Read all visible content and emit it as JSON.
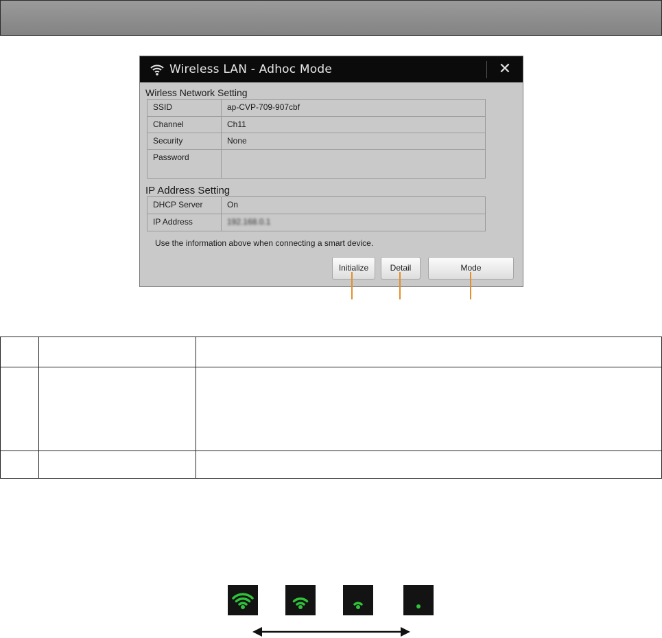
{
  "dialog": {
    "title": "Wireless LAN - Adhoc Mode",
    "title_icon": "wifi-icon",
    "close_icon": "close-icon",
    "close_glyph": "✕",
    "wireless_section": {
      "title": "Wirless Network Setting",
      "rows": [
        {
          "label": "SSID",
          "value": "ap-CVP-709-907cbf"
        },
        {
          "label": "Channel",
          "value": "Ch11"
        },
        {
          "label": "Security",
          "value": "None"
        },
        {
          "label": "Password",
          "value": ""
        }
      ]
    },
    "ip_section": {
      "title": "IP Address Setting",
      "rows": [
        {
          "label": "DHCP Server",
          "value": "On"
        },
        {
          "label": "IP Address",
          "value": "192.168.0.1"
        }
      ]
    },
    "note": "Use the information above when connecting a smart device.",
    "buttons": {
      "initialize": "Initialize",
      "detail": "Detail",
      "mode": "Mode"
    }
  },
  "colors": {
    "callout": "#e38f2a",
    "signal_green": "#2fc23a",
    "dialog_bg": "#c9c9c9"
  },
  "signal_levels": [
    {
      "icon": "signal-strength-3-icon",
      "bars": 3
    },
    {
      "icon": "signal-strength-2-icon",
      "bars": 2
    },
    {
      "icon": "signal-strength-1-icon",
      "bars": 1
    },
    {
      "icon": "signal-strength-0-icon",
      "bars": 0
    }
  ]
}
